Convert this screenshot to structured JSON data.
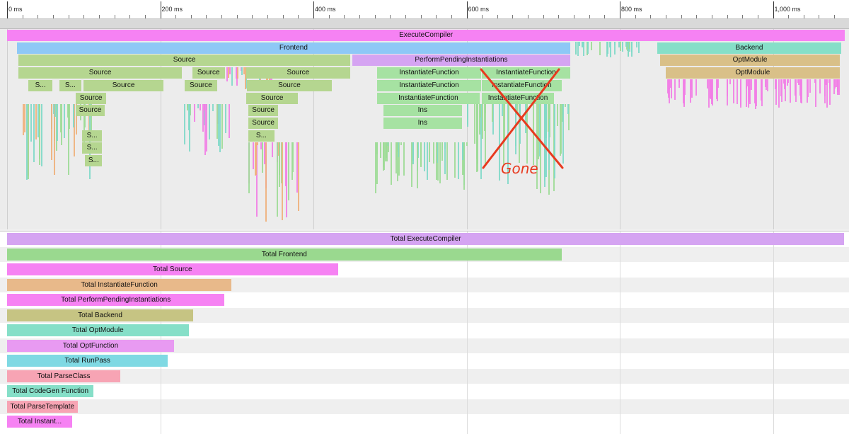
{
  "ruler": {
    "labels": [
      {
        "ms": 0,
        "text": "0 ms"
      },
      {
        "ms": 200,
        "text": "200 ms"
      },
      {
        "ms": 400,
        "text": "400 ms"
      },
      {
        "ms": 600,
        "text": "600 ms"
      },
      {
        "ms": 800,
        "text": "800 ms"
      },
      {
        "ms": 1000,
        "text": "1,000 ms"
      }
    ]
  },
  "colors": {
    "execute": "#f682f3",
    "frontend": "#8ec8f6",
    "source": "#b5d690",
    "pending": "#d5a4f2",
    "instantiate": "#a6e2a2",
    "backend": "#86dfc8",
    "optmodule": "#d9c088",
    "spike_pink": "#f27ee5",
    "spike_orange": "#f0b07a",
    "spike_teal": "#7fd9c9",
    "spike_green": "#9ddc96",
    "annotation_red": "#e83a1f"
  },
  "flame_bars": [
    {
      "name": "ExecuteCompiler",
      "start": 0,
      "end": 1095,
      "depth": 0,
      "color": "execute"
    },
    {
      "name": "Frontend",
      "start": 13,
      "end": 736,
      "depth": 1,
      "color": "frontend"
    },
    {
      "name": "Backend",
      "start": 849,
      "end": 1090,
      "depth": 1,
      "color": "backend"
    },
    {
      "name": "Source",
      "start": 15,
      "end": 449,
      "depth": 2,
      "color": "source"
    },
    {
      "name": "PerformPendingInstantiations",
      "start": 451,
      "end": 736,
      "depth": 2,
      "color": "pending"
    },
    {
      "name": "OptModule",
      "start": 853,
      "end": 1088,
      "depth": 2,
      "color": "optmodule"
    },
    {
      "name": "Source",
      "start": 15,
      "end": 229,
      "depth": 3,
      "color": "source"
    },
    {
      "name": "Source",
      "start": 242,
      "end": 285,
      "depth": 3,
      "color": "source"
    },
    {
      "name": "Source",
      "start": 312,
      "end": 449,
      "depth": 3,
      "color": "source"
    },
    {
      "name": "InstantiateFunction",
      "start": 483,
      "end": 620,
      "depth": 3,
      "color": "instantiate"
    },
    {
      "name": "InstantiateFunction",
      "start": 620,
      "end": 736,
      "depth": 3,
      "color": "instantiate"
    },
    {
      "name": "OptModule",
      "start": 860,
      "end": 1088,
      "depth": 3,
      "color": "optmodule"
    },
    {
      "name": "S...",
      "start": 28,
      "end": 60,
      "depth": 4,
      "color": "source"
    },
    {
      "name": "S...",
      "start": 68,
      "end": 98,
      "depth": 4,
      "color": "source"
    },
    {
      "name": "Source",
      "start": 100,
      "end": 205,
      "depth": 4,
      "color": "source"
    },
    {
      "name": "Source",
      "start": 232,
      "end": 275,
      "depth": 4,
      "color": "source"
    },
    {
      "name": "Source",
      "start": 313,
      "end": 425,
      "depth": 4,
      "color": "source"
    },
    {
      "name": "InstantiateFunction",
      "start": 483,
      "end": 620,
      "depth": 4,
      "color": "instantiate"
    },
    {
      "name": "InstantiateFunction",
      "start": 620,
      "end": 725,
      "depth": 4,
      "color": "instantiate"
    },
    {
      "name": "Source",
      "start": 90,
      "end": 130,
      "depth": 5,
      "color": "source"
    },
    {
      "name": "Source",
      "start": 312,
      "end": 381,
      "depth": 5,
      "color": "source"
    },
    {
      "name": "InstantiateFunction",
      "start": 483,
      "end": 618,
      "depth": 5,
      "color": "instantiate"
    },
    {
      "name": "InstantiateFunction",
      "start": 620,
      "end": 715,
      "depth": 5,
      "color": "instantiate"
    },
    {
      "name": "Source",
      "start": 90,
      "end": 128,
      "depth": 6,
      "color": "source"
    },
    {
      "name": "Source",
      "start": 315,
      "end": 355,
      "depth": 6,
      "color": "source"
    },
    {
      "name": "Ins",
      "start": 491,
      "end": 595,
      "depth": 6,
      "color": "instantiate"
    },
    {
      "name": "Source",
      "start": 315,
      "end": 355,
      "depth": 7,
      "color": "source"
    },
    {
      "name": "Ins",
      "start": 491,
      "end": 595,
      "depth": 7,
      "color": "instantiate"
    },
    {
      "name": "S...",
      "start": 98,
      "end": 125,
      "depth": 8,
      "color": "source"
    },
    {
      "name": "S...",
      "start": 315,
      "end": 350,
      "depth": 8,
      "color": "source"
    },
    {
      "name": "S...",
      "start": 98,
      "end": 125,
      "depth": 9,
      "color": "source"
    },
    {
      "name": "S...",
      "start": 102,
      "end": 125,
      "depth": 10,
      "color": "source"
    }
  ],
  "annotation": {
    "text": "Gone"
  },
  "totals": [
    {
      "label": "Total ExecuteCompiler",
      "ms": 1093,
      "color": "#d5a4f2"
    },
    {
      "label": "Total Frontend",
      "ms": 724,
      "color": "#9ad98f"
    },
    {
      "label": "Total Source",
      "ms": 432,
      "color": "#f682f3"
    },
    {
      "label": "Total InstantiateFunction",
      "ms": 293,
      "color": "#e8b98a"
    },
    {
      "label": "Total PerformPendingInstantiations",
      "ms": 284,
      "color": "#f682f3"
    },
    {
      "label": "Total Backend",
      "ms": 243,
      "color": "#c6c483"
    },
    {
      "label": "Total OptModule",
      "ms": 237,
      "color": "#86dfc8"
    },
    {
      "label": "Total OptFunction",
      "ms": 218,
      "color": "#e89af2"
    },
    {
      "label": "Total RunPass",
      "ms": 210,
      "color": "#7fd9e3"
    },
    {
      "label": "Total ParseClass",
      "ms": 148,
      "color": "#f7a4b4"
    },
    {
      "label": "Total CodeGen Function",
      "ms": 113,
      "color": "#86dfc8"
    },
    {
      "label": "Total ParseTemplate",
      "ms": 92,
      "color": "#f7a4b4"
    },
    {
      "label": "Total Instant...",
      "ms": 85,
      "color": "#f682f3"
    }
  ]
}
